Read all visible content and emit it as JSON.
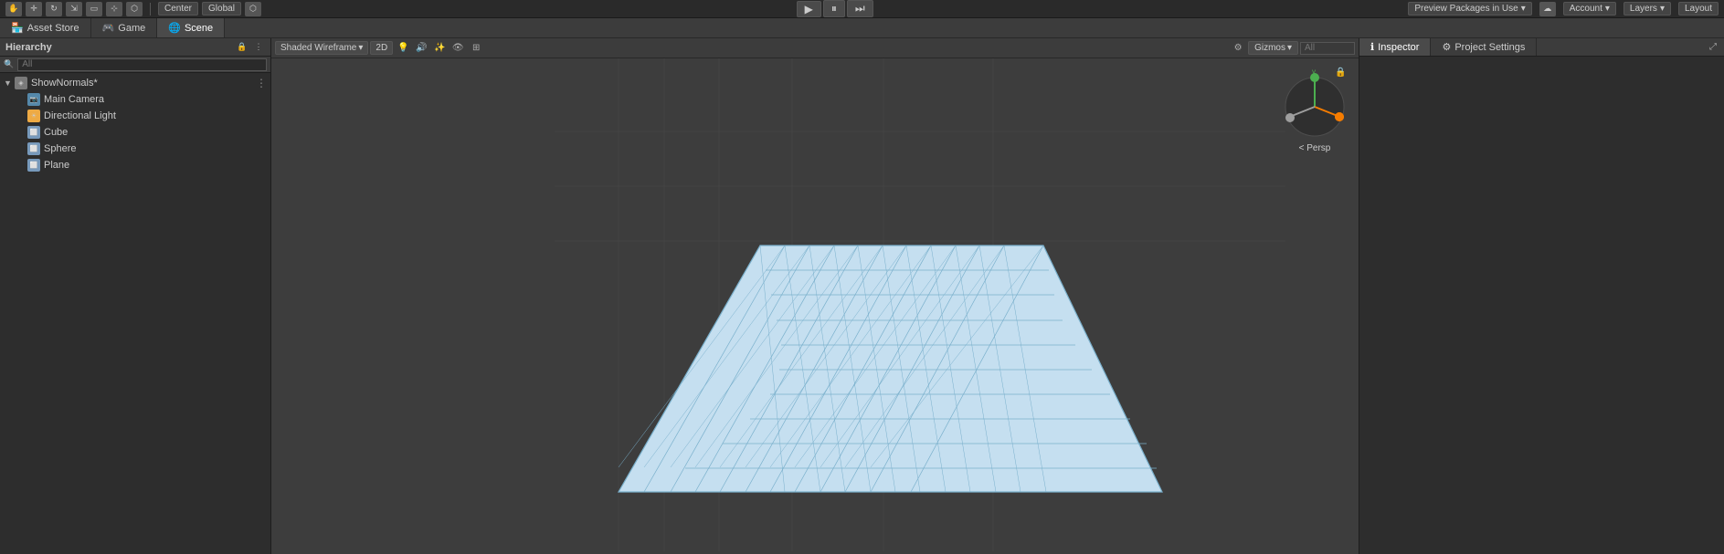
{
  "topbar": {
    "tools": [
      "hand",
      "move",
      "rotate",
      "scale",
      "rect",
      "transform",
      "settings"
    ],
    "center_label": "Center",
    "global_label": "Global",
    "play_btn": "▶",
    "pause_btn": "⏸",
    "step_btn": "⏭",
    "preview_packages_label": "Preview Packages in Use",
    "account_label": "Account",
    "layers_label": "Layers",
    "layout_label": "Layout"
  },
  "tabs": {
    "asset_store": "Asset Store",
    "game": "Game",
    "scene": "Scene"
  },
  "hierarchy": {
    "title": "Hierarchy",
    "search_placeholder": "All",
    "root_item": "ShowNormals*",
    "items": [
      {
        "name": "Main Camera",
        "type": "camera",
        "depth": 1
      },
      {
        "name": "Directional Light",
        "type": "light",
        "depth": 1
      },
      {
        "name": "Cube",
        "type": "cube",
        "depth": 1
      },
      {
        "name": "Sphere",
        "type": "sphere",
        "depth": 1
      },
      {
        "name": "Plane",
        "type": "plane",
        "depth": 1
      }
    ]
  },
  "scene": {
    "shading_mode": "Shaded Wireframe",
    "view_2d": "2D",
    "gizmos_label": "Gizmos",
    "search_placeholder": "All",
    "persp_label": "< Persp"
  },
  "inspector": {
    "title": "Inspector",
    "project_settings_label": "Project Settings"
  }
}
